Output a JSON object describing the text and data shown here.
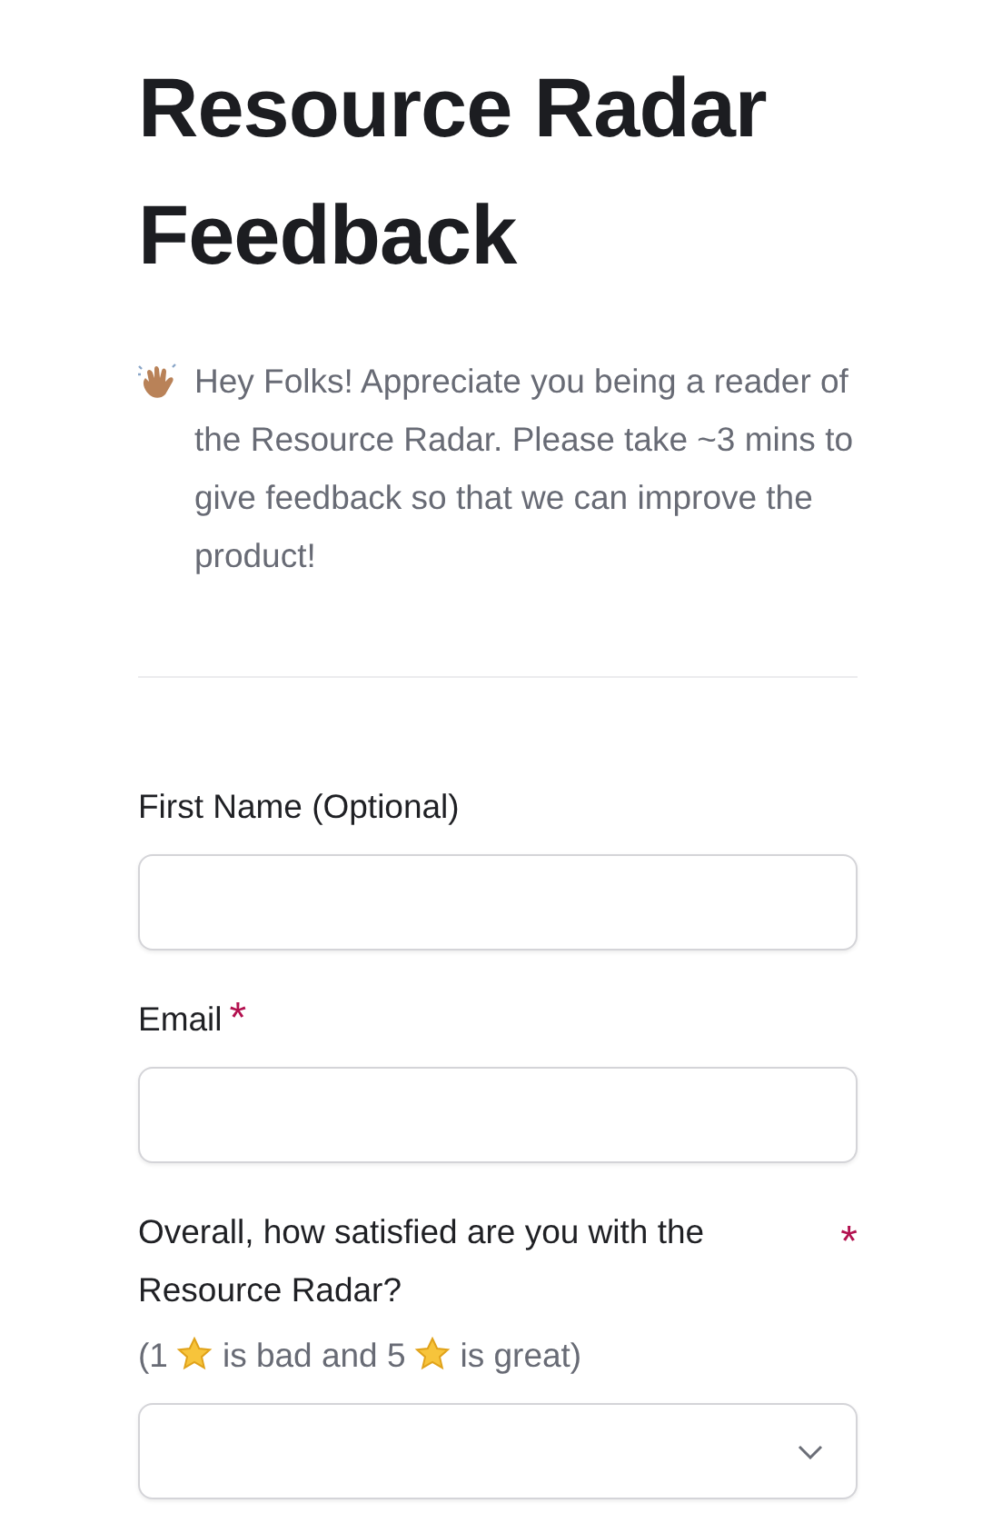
{
  "title": "Resource Radar Feedback",
  "intro": "Hey Folks! Appreciate you being a reader of the Resource Radar. Please take ~3 mins to give feedback so that we can improve the product!",
  "fields": [
    {
      "kind": "text",
      "label": "First Name (Optional)"
    },
    {
      "kind": "text",
      "label": "Email",
      "required_mark": "*"
    },
    {
      "kind": "select",
      "label": "Overall, how satisfied are you with the Resource Radar?",
      "required_mark": "*",
      "hint": [
        "(1",
        "is bad and 5",
        "is great)"
      ]
    }
  ]
}
